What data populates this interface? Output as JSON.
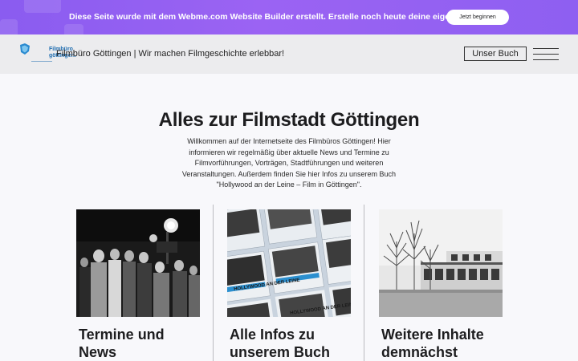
{
  "promo": {
    "text": "Diese Seite wurde mit dem Webme.com Website Builder erstellt. Erstelle noch heute deine eigene Website.",
    "cta_label": "Jetzt beginnen"
  },
  "header": {
    "logo_line1": "Filmbüro",
    "logo_line2": "göttingen.",
    "title": "Filmbüro Göttingen | Wir machen Filmgeschichte erlebbar!",
    "book_button": "Unser Buch"
  },
  "hero": {
    "title": "Alles zur Filmstadt Göttingen",
    "text": "Willkommen auf der Internetseite des Filmbüros Göttingen! Hier informieren wir regelmäßig über aktuelle News und Termine zu Filmvorführungen, Vorträgen, Stadtführungen und weiteren Veranstaltungen. Außerdem finden Sie hier Infos zu unserem Buch \"Hollywood an der Leine – Film in Göttingen\"."
  },
  "cards": [
    {
      "title_line1": "Termine und",
      "title_line2": "News"
    },
    {
      "title_line1": "Alle Infos zu",
      "title_line2": "unserem Buch",
      "book_cover_1": "HOLLYWOOD AN DER LEINE",
      "book_cover_2": "HOLLYWOOD AN DER LEINE"
    },
    {
      "title_line1": "Weitere Inhalte",
      "title_line2": "demnächst"
    }
  ],
  "colors": {
    "promo": "#8a5cf0",
    "header_bg": "#ececee",
    "page_bg": "#f8f8fb",
    "logo_blue": "#1f6db0"
  }
}
